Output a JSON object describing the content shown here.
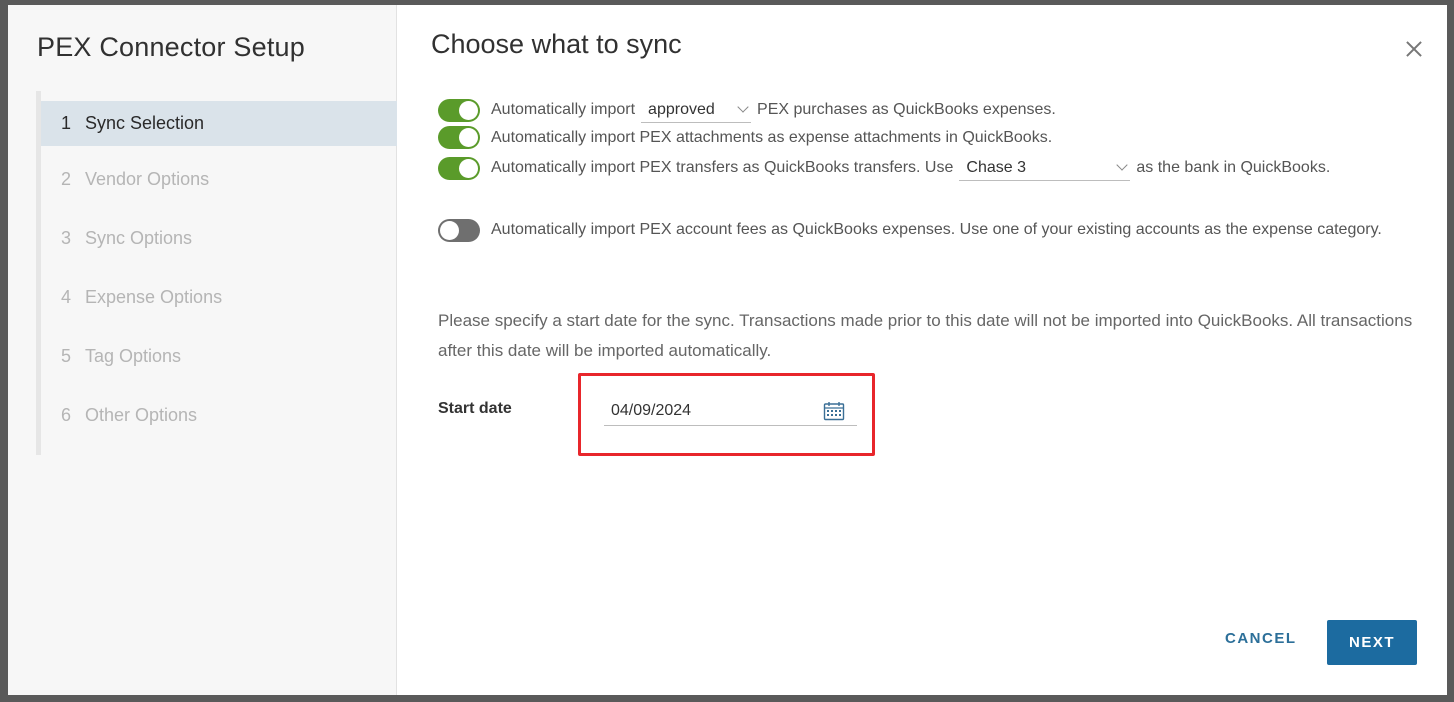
{
  "sidebar": {
    "title": "PEX Connector Setup",
    "steps": [
      {
        "num": "1",
        "label": "Sync Selection",
        "active": true
      },
      {
        "num": "2",
        "label": "Vendor Options",
        "active": false
      },
      {
        "num": "3",
        "label": "Sync Options",
        "active": false
      },
      {
        "num": "4",
        "label": "Expense Options",
        "active": false
      },
      {
        "num": "5",
        "label": "Tag Options",
        "active": false
      },
      {
        "num": "6",
        "label": "Other Options",
        "active": false
      }
    ]
  },
  "main": {
    "title": "Choose what to sync",
    "options": {
      "purchases": {
        "enabled": true,
        "prefix": "Automatically import",
        "select_value": "approved",
        "suffix": "PEX purchases as QuickBooks expenses."
      },
      "attachments": {
        "enabled": true,
        "text": "Automatically import PEX attachments as expense attachments in QuickBooks."
      },
      "transfers": {
        "enabled": true,
        "prefix": "Automatically import PEX transfers as QuickBooks transfers. Use",
        "select_value": "Chase 3",
        "suffix": "as the bank in QuickBooks."
      },
      "fees": {
        "enabled": false,
        "text": "Automatically import PEX account fees as QuickBooks expenses. Use one of your existing accounts as the expense category."
      }
    },
    "note": "Please specify a start date for the sync. Transactions made prior to this date will not be imported into QuickBooks. All transactions after this date will be imported automatically.",
    "start_date": {
      "label": "Start date",
      "value": "04/09/2024"
    }
  },
  "footer": {
    "cancel_label": "CANCEL",
    "next_label": "NEXT"
  },
  "colors": {
    "toggle_on": "#5a9b2a",
    "toggle_off": "#6f6f6f",
    "primary": "#1c6ba0",
    "highlight": "#e8262b",
    "active_step_bg": "#dae3ea"
  }
}
